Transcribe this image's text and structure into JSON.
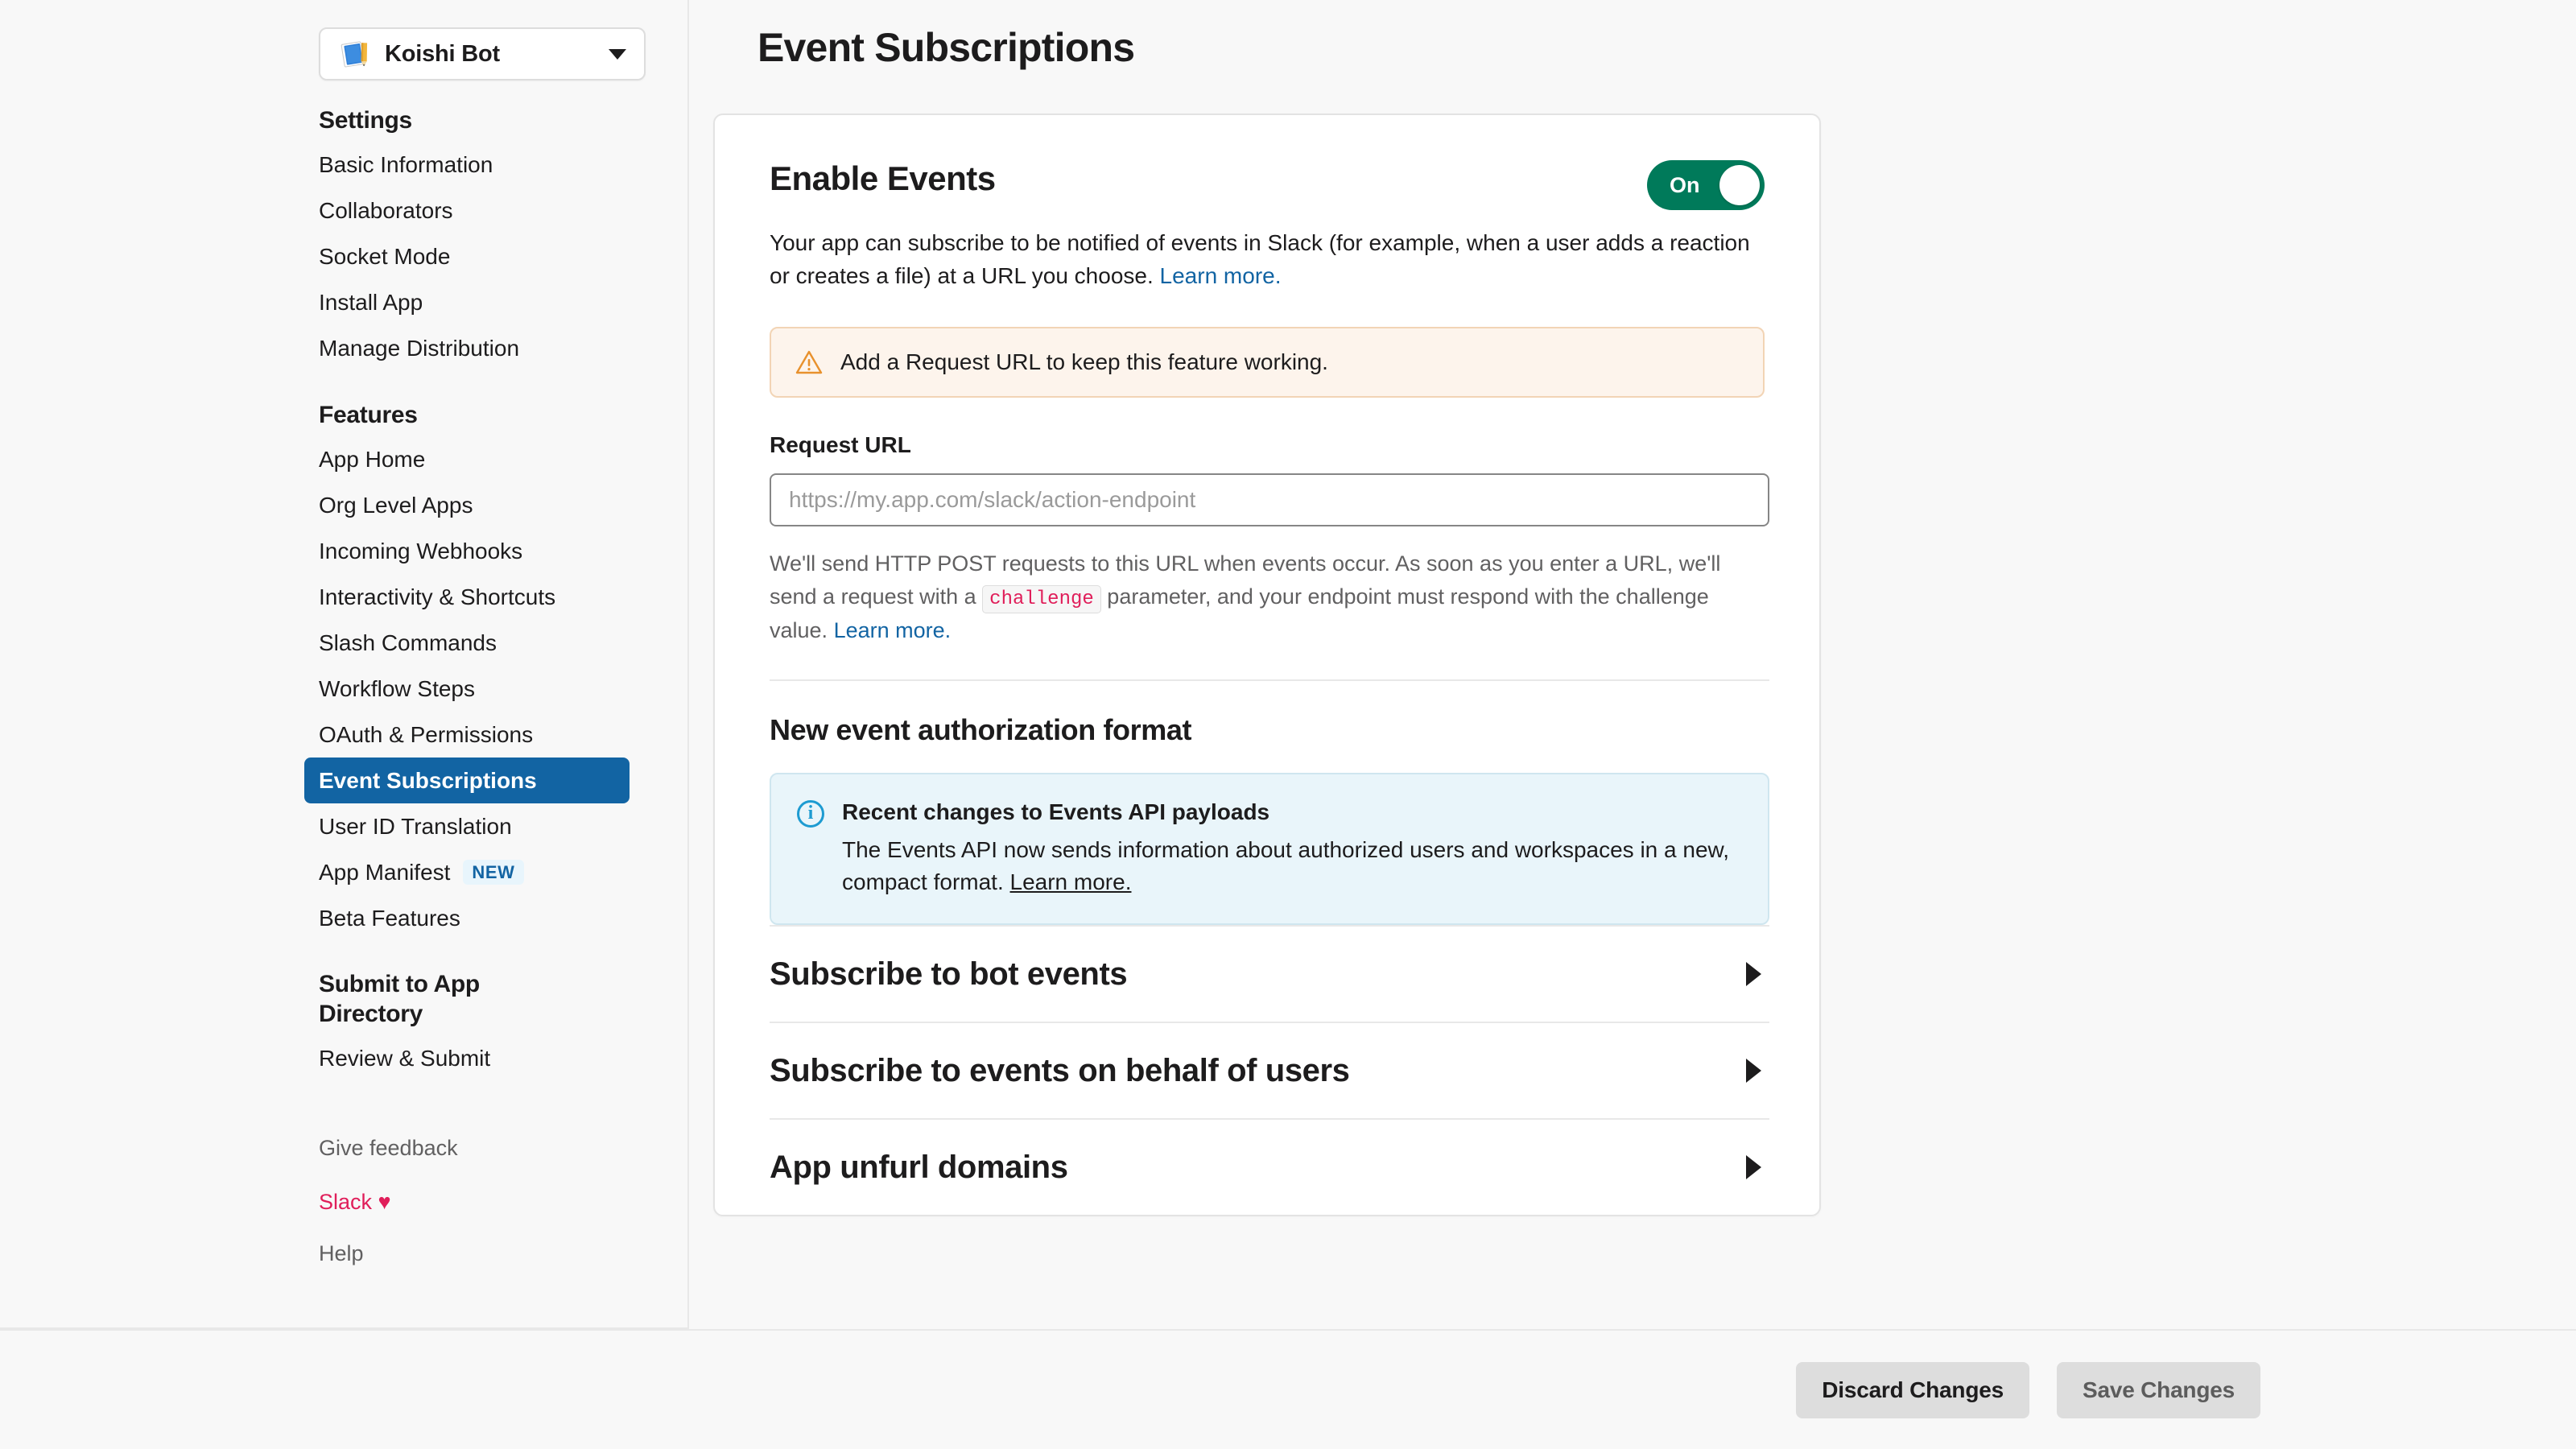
{
  "app_picker": {
    "name": "Koishi Bot",
    "icon": "book-pencil-icon",
    "caret": "chevron-down-icon"
  },
  "sidebar": {
    "sections": [
      {
        "heading": "Settings",
        "items": [
          {
            "label": "Basic Information",
            "active": false
          },
          {
            "label": "Collaborators",
            "active": false
          },
          {
            "label": "Socket Mode",
            "active": false
          },
          {
            "label": "Install App",
            "active": false
          },
          {
            "label": "Manage Distribution",
            "active": false
          }
        ]
      },
      {
        "heading": "Features",
        "items": [
          {
            "label": "App Home",
            "active": false
          },
          {
            "label": "Org Level Apps",
            "active": false
          },
          {
            "label": "Incoming Webhooks",
            "active": false
          },
          {
            "label": "Interactivity & Shortcuts",
            "active": false
          },
          {
            "label": "Slash Commands",
            "active": false
          },
          {
            "label": "Workflow Steps",
            "active": false
          },
          {
            "label": "OAuth & Permissions",
            "active": false
          },
          {
            "label": "Event Subscriptions",
            "active": true
          },
          {
            "label": "User ID Translation",
            "active": false
          },
          {
            "label": "App Manifest",
            "active": false,
            "badge": "NEW"
          },
          {
            "label": "Beta Features",
            "active": false
          }
        ]
      },
      {
        "heading": "Submit to App Directory",
        "items": [
          {
            "label": "Review & Submit",
            "active": false
          }
        ]
      }
    ],
    "footer": {
      "give_feedback": "Give feedback",
      "slack_love": "Slack ♥",
      "help": "Help"
    }
  },
  "header": {
    "title": "Event Subscriptions"
  },
  "enable_events": {
    "title": "Enable Events",
    "toggle_label": "On",
    "toggle_state": "on",
    "toggle_color": "#007a5a",
    "description_part1": "Your app can subscribe to be notified of events in Slack (for example, when a user adds a reaction or creates a file) at a URL you choose. ",
    "description_link": "Learn more."
  },
  "warning": {
    "icon": "warning-triangle-icon",
    "text": "Add a Request URL to keep this feature working.",
    "bg_color": "#fdf4ec",
    "icon_color": "#e8912d"
  },
  "request_url": {
    "label": "Request URL",
    "value": "",
    "placeholder": "https://my.app.com/slack/action-endpoint",
    "help_part1": "We'll send HTTP POST requests to this URL when events occur. As soon as you enter a URL, we'll send a request with a ",
    "help_code": "challenge",
    "help_part2": " parameter, and your endpoint must respond with the challenge value. ",
    "help_link": "Learn more."
  },
  "auth_format": {
    "title": "New event authorization format",
    "info_icon": "info-circle-icon",
    "info_title": "Recent changes to Events API payloads",
    "info_body": "The Events API now sends information about authorized users and workspaces in a new, compact format. ",
    "info_link": "Learn more.",
    "bg_color": "#e9f5fa",
    "icon_color": "#1d9bd1"
  },
  "accordions": [
    {
      "label": "Subscribe to bot events",
      "chevron": "chevron-right-icon"
    },
    {
      "label": "Subscribe to events on behalf of users",
      "chevron": "chevron-right-icon"
    },
    {
      "label": "App unfurl domains",
      "chevron": "chevron-right-icon"
    }
  ],
  "bottom_bar": {
    "discard_label": "Discard Changes",
    "save_label": "Save Changes"
  }
}
